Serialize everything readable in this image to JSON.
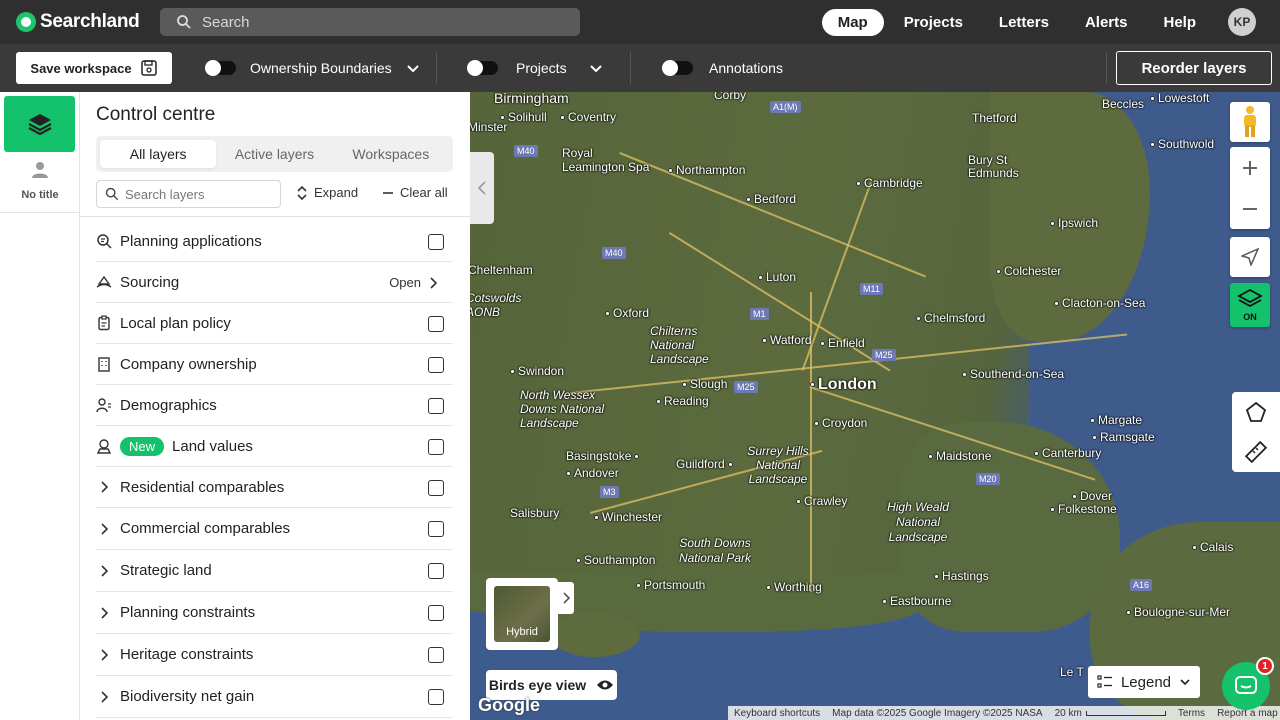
{
  "app": {
    "name": "Searchland",
    "search_placeholder": "Search",
    "nav": [
      "Map",
      "Projects",
      "Letters",
      "Alerts",
      "Help"
    ],
    "active_nav": "Map",
    "user_initials": "KP"
  },
  "toolbar": {
    "save_label": "Save workspace",
    "toggles": [
      "Ownership Boundaries",
      "Projects",
      "Annotations"
    ],
    "reorder_label": "Reorder layers"
  },
  "rail": {
    "user_label": "No title"
  },
  "panel": {
    "title": "Control centre",
    "tabs": [
      "All layers",
      "Active layers",
      "Workspaces"
    ],
    "active_tab": "All layers",
    "search_placeholder": "Search layers",
    "expand_label": "Expand",
    "clear_label": "Clear all",
    "layers": [
      {
        "label": "Planning applications",
        "icon": "search-doc-icon",
        "control": "checkbox"
      },
      {
        "label": "Sourcing",
        "icon": "sourcing-icon",
        "control": "open",
        "open_label": "Open"
      },
      {
        "label": "Local plan policy",
        "icon": "clipboard-icon",
        "control": "checkbox"
      },
      {
        "label": "Company ownership",
        "icon": "building-icon",
        "control": "checkbox"
      },
      {
        "label": "Demographics",
        "icon": "people-icon",
        "control": "checkbox"
      },
      {
        "label": "Land values",
        "icon": "land-value-icon",
        "control": "checkbox",
        "badge": "New"
      },
      {
        "label": "Residential comparables",
        "icon": "chevron-right-icon",
        "control": "checkbox"
      },
      {
        "label": "Commercial comparables",
        "icon": "chevron-right-icon",
        "control": "checkbox"
      },
      {
        "label": "Strategic land",
        "icon": "chevron-right-icon",
        "control": "checkbox"
      },
      {
        "label": "Planning constraints",
        "icon": "chevron-right-icon",
        "control": "checkbox"
      },
      {
        "label": "Heritage constraints",
        "icon": "chevron-right-icon",
        "control": "checkbox"
      },
      {
        "label": "Biodiversity net gain",
        "icon": "chevron-right-icon",
        "control": "checkbox"
      }
    ]
  },
  "map": {
    "places": [
      "Birmingham",
      "Solihull",
      "Coventry",
      "Corby",
      "Royal Leamington Spa",
      "Northampton",
      "Bedford",
      "Cambridge",
      "Bury St Edmunds",
      "Thetford",
      "Beccles",
      "Lowestoft",
      "Southwold",
      "Ipswich",
      "Cheltenham",
      "Oxford",
      "Luton",
      "Colchester",
      "Clacton-on-Sea",
      "Chelmsford",
      "Watford",
      "Enfield",
      "Chilterns National Landscape",
      "Swindon",
      "Slough",
      "Reading",
      "London",
      "Southend-on-Sea",
      "North Wessex Downs National Landscape",
      "Croydon",
      "Margate",
      "Ramsgate",
      "Basingstoke",
      "Andover",
      "Guildford",
      "Surrey Hills National Landscape",
      "Maidstone",
      "Canterbury",
      "Crawley",
      "Dover",
      "Folkestone",
      "Salisbury",
      "Winchester",
      "High Weald National Landscape",
      "South Downs National Park",
      "Calais",
      "Southampton",
      "Portsmouth",
      "Worthing",
      "Hastings",
      "Eastbourne",
      "Boulogne-sur-Mer",
      "Cotswolds AONB",
      "Minster",
      "Le T"
    ],
    "motorways": [
      "A1(M)",
      "M40",
      "M40",
      "M11",
      "M1",
      "M25",
      "M25",
      "M3",
      "M20",
      "A16"
    ],
    "layers_on_label": "ON",
    "basemap_label": "Hybrid",
    "birds_eye_label": "Birds eye view",
    "legend_label": "Legend",
    "chat_count": "1",
    "google_label": "Google",
    "attribution": {
      "shortcuts": "Keyboard shortcuts",
      "data": "Map data ©2025 Google Imagery ©2025 NASA",
      "scale": "20 km",
      "terms": "Terms",
      "report": "Report a map error"
    }
  }
}
